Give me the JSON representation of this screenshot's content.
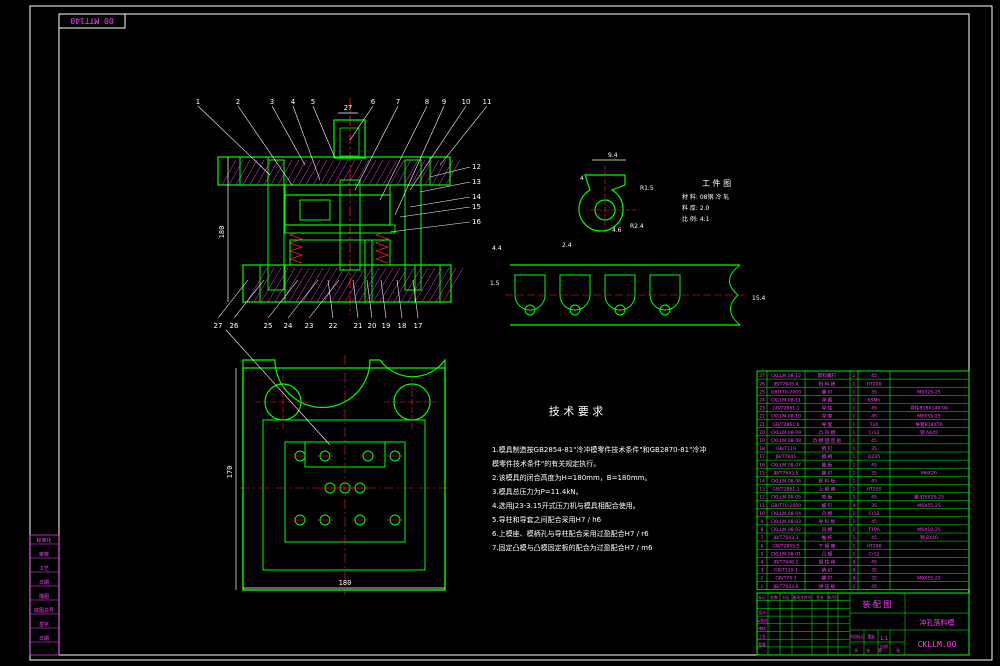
{
  "colors": {
    "background": "#000000",
    "frame": "#ffffff",
    "part_lines": "#00ff00",
    "center_lines": "#ff2020",
    "leaders": "#ffffff",
    "dimensions": "#ffffff",
    "table_lines": "#00ff00",
    "table_text": "#ff40ff",
    "title_text": "#ff40ff",
    "hatch": "#ff40ff"
  },
  "header": {
    "stamp": "00 MTT140"
  },
  "main_view": {
    "part_numbers_top": [
      "1",
      "2",
      "3",
      "4",
      "5",
      "6",
      "7",
      "8",
      "9",
      "10",
      "11"
    ],
    "part_numbers_right": [
      "12",
      "13",
      "14",
      "15",
      "16"
    ],
    "part_numbers_bottom": [
      "27",
      "26",
      "25",
      "24",
      "23",
      "22",
      "21",
      "20",
      "19",
      "18",
      "17"
    ],
    "height_dim": "180",
    "top_dim": "27"
  },
  "plan_view": {
    "height_dim": "170",
    "width_dim": "180"
  },
  "workpiece": {
    "title": "工 件 图",
    "material": "材 料: 08钢 冷 轧",
    "thickness": "料 厚: 2.0",
    "scale": "比 例: 4:1",
    "dims": [
      "9.4",
      "4",
      "R1.5",
      "4.6",
      "R2.4"
    ]
  },
  "strip": {
    "dims": [
      "4.4",
      "2.4",
      "1.5",
      "15.4"
    ]
  },
  "tech_requirements": {
    "title": "技 术 要 求",
    "lines": [
      "1.模具制造按GB2854-81\"冷冲模零件技术条件\"和GB2870-81\"冷冲",
      "模零件技术条件\"的有关规定执行。",
      "2.该模具的闭合高度为H=180mm，B=180mm。",
      "3.模具总压力为P=11.4kN。",
      "4.选用J23-3.15开式压力机与模具相配合使用。",
      "5.导柱和导套之间配合采用H7 / h6",
      "6.上模座、模柄孔与导柱配合采用过盈配合H7 / r6",
      "7.固定凸模与凸模固定板的配合为过盈配合H7 / m6"
    ]
  },
  "left_block": {
    "labels": [
      "标准化",
      "审核",
      "工艺",
      "日期",
      "描图",
      "底图总号",
      "签字",
      "日期"
    ]
  },
  "bom_rows": [
    [
      "27",
      "CKLLM.08-12",
      "卸料螺钉",
      "2",
      "45",
      ""
    ],
    [
      "26",
      "JB/T7645.4",
      "挡 料 销",
      "1",
      "HT200",
      ""
    ],
    [
      "25",
      "GB/T70-2000",
      "螺 钉",
      "1",
      "35",
      "M6X25-25"
    ],
    [
      "24",
      "CKLLM.08-11",
      "弹 簧",
      "1",
      "65Mn",
      ""
    ],
    [
      "23",
      "GB/T2861.1",
      "导 柱",
      "1",
      "45",
      "导柱B18X140-90"
    ],
    [
      "22",
      "CKLLM.08-10",
      "导 套",
      "1",
      "45",
      "M6X55-25"
    ],
    [
      "21",
      "GB/T2861.6",
      "导 套",
      "1",
      "T10",
      "导套B18X70"
    ],
    [
      "20",
      "CKLLM.08-09",
      "凸 凹 模",
      "1",
      "Cr12",
      "销 6X45"
    ],
    [
      "19",
      "CKLLM.08-08",
      "凸 模 固 定 板",
      "1",
      "45",
      ""
    ],
    [
      "18",
      "GB/T119",
      "销 钉",
      "1",
      "35",
      ""
    ],
    [
      "17",
      "JB/T7641",
      "模 柄",
      "1",
      "Q235",
      ""
    ],
    [
      "16",
      "CKLLM.08-07",
      "推 板",
      "1",
      "45",
      ""
    ],
    [
      "15",
      "JB/T7643.5",
      "螺 钉",
      "1",
      "35",
      "M6X20"
    ],
    [
      "14",
      "CKLLM.08-06",
      "卸 料 板",
      "1",
      "45",
      ""
    ],
    [
      "13",
      "GB/T2861.1",
      "上 模 座",
      "1",
      "HT200",
      ""
    ],
    [
      "12",
      "CKLLM.08-05",
      "垫 板",
      "1",
      "45",
      "螺 钉6X25-25"
    ],
    [
      "11",
      "GB/T70-2000",
      "螺 钉",
      "4",
      "35",
      "M6X55-25"
    ],
    [
      "10",
      "CKLLM.08-04",
      "凸 模",
      "1",
      "Cr12",
      ""
    ],
    [
      "9",
      "CKLLM.08-03",
      "导 料 板",
      "1",
      "45",
      ""
    ],
    [
      "8",
      "CKLLM.08-02",
      "凹 模",
      "1",
      "T10A",
      "M6X10-25"
    ],
    [
      "7",
      "JB/T7643.3",
      "推 杆",
      "1",
      "45",
      "销 8X40"
    ],
    [
      "6",
      "GB/T2855.5",
      "下 模 座",
      "1",
      "HT200",
      ""
    ],
    [
      "5",
      "CKLLM.08-01",
      "凸 模",
      "1",
      "Cr12",
      ""
    ],
    [
      "4",
      "JB/T7646.1",
      "圆 柱 销",
      "4",
      "45",
      ""
    ],
    [
      "3",
      "GB/T119.1",
      "销 钉",
      "4",
      "35",
      ""
    ],
    [
      "2",
      "GB/T70.1",
      "螺 钉",
      "4",
      "35",
      "M6X55-25"
    ],
    [
      "1",
      "JB/T7643.6",
      "弹 压 板",
      "1",
      "45",
      ""
    ]
  ],
  "title_block": {
    "drawing_name": "装 配 图",
    "company": "冲孔落料模",
    "code": "CKLLM.00",
    "small_labels": [
      "标记",
      "处数",
      "分区",
      "更改文件号",
      "签名",
      "年月日",
      "设计",
      "标准化",
      "审核",
      "工艺",
      "批准",
      "阶段标记",
      "重量",
      "比例",
      "共",
      "张",
      "第",
      "张"
    ],
    "scale": "1:1"
  }
}
